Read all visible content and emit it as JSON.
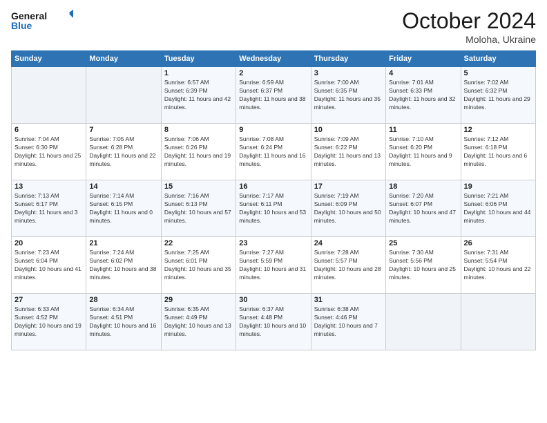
{
  "header": {
    "logo_line1": "General",
    "logo_line2": "Blue",
    "month": "October 2024",
    "location": "Moloha, Ukraine"
  },
  "weekdays": [
    "Sunday",
    "Monday",
    "Tuesday",
    "Wednesday",
    "Thursday",
    "Friday",
    "Saturday"
  ],
  "weeks": [
    [
      {
        "day": "",
        "info": ""
      },
      {
        "day": "",
        "info": ""
      },
      {
        "day": "1",
        "info": "Sunrise: 6:57 AM\nSunset: 6:39 PM\nDaylight: 11 hours and 42 minutes."
      },
      {
        "day": "2",
        "info": "Sunrise: 6:59 AM\nSunset: 6:37 PM\nDaylight: 11 hours and 38 minutes."
      },
      {
        "day": "3",
        "info": "Sunrise: 7:00 AM\nSunset: 6:35 PM\nDaylight: 11 hours and 35 minutes."
      },
      {
        "day": "4",
        "info": "Sunrise: 7:01 AM\nSunset: 6:33 PM\nDaylight: 11 hours and 32 minutes."
      },
      {
        "day": "5",
        "info": "Sunrise: 7:02 AM\nSunset: 6:32 PM\nDaylight: 11 hours and 29 minutes."
      }
    ],
    [
      {
        "day": "6",
        "info": "Sunrise: 7:04 AM\nSunset: 6:30 PM\nDaylight: 11 hours and 25 minutes."
      },
      {
        "day": "7",
        "info": "Sunrise: 7:05 AM\nSunset: 6:28 PM\nDaylight: 11 hours and 22 minutes."
      },
      {
        "day": "8",
        "info": "Sunrise: 7:06 AM\nSunset: 6:26 PM\nDaylight: 11 hours and 19 minutes."
      },
      {
        "day": "9",
        "info": "Sunrise: 7:08 AM\nSunset: 6:24 PM\nDaylight: 11 hours and 16 minutes."
      },
      {
        "day": "10",
        "info": "Sunrise: 7:09 AM\nSunset: 6:22 PM\nDaylight: 11 hours and 13 minutes."
      },
      {
        "day": "11",
        "info": "Sunrise: 7:10 AM\nSunset: 6:20 PM\nDaylight: 11 hours and 9 minutes."
      },
      {
        "day": "12",
        "info": "Sunrise: 7:12 AM\nSunset: 6:18 PM\nDaylight: 11 hours and 6 minutes."
      }
    ],
    [
      {
        "day": "13",
        "info": "Sunrise: 7:13 AM\nSunset: 6:17 PM\nDaylight: 11 hours and 3 minutes."
      },
      {
        "day": "14",
        "info": "Sunrise: 7:14 AM\nSunset: 6:15 PM\nDaylight: 11 hours and 0 minutes."
      },
      {
        "day": "15",
        "info": "Sunrise: 7:16 AM\nSunset: 6:13 PM\nDaylight: 10 hours and 57 minutes."
      },
      {
        "day": "16",
        "info": "Sunrise: 7:17 AM\nSunset: 6:11 PM\nDaylight: 10 hours and 53 minutes."
      },
      {
        "day": "17",
        "info": "Sunrise: 7:19 AM\nSunset: 6:09 PM\nDaylight: 10 hours and 50 minutes."
      },
      {
        "day": "18",
        "info": "Sunrise: 7:20 AM\nSunset: 6:07 PM\nDaylight: 10 hours and 47 minutes."
      },
      {
        "day": "19",
        "info": "Sunrise: 7:21 AM\nSunset: 6:06 PM\nDaylight: 10 hours and 44 minutes."
      }
    ],
    [
      {
        "day": "20",
        "info": "Sunrise: 7:23 AM\nSunset: 6:04 PM\nDaylight: 10 hours and 41 minutes."
      },
      {
        "day": "21",
        "info": "Sunrise: 7:24 AM\nSunset: 6:02 PM\nDaylight: 10 hours and 38 minutes."
      },
      {
        "day": "22",
        "info": "Sunrise: 7:25 AM\nSunset: 6:01 PM\nDaylight: 10 hours and 35 minutes."
      },
      {
        "day": "23",
        "info": "Sunrise: 7:27 AM\nSunset: 5:59 PM\nDaylight: 10 hours and 31 minutes."
      },
      {
        "day": "24",
        "info": "Sunrise: 7:28 AM\nSunset: 5:57 PM\nDaylight: 10 hours and 28 minutes."
      },
      {
        "day": "25",
        "info": "Sunrise: 7:30 AM\nSunset: 5:56 PM\nDaylight: 10 hours and 25 minutes."
      },
      {
        "day": "26",
        "info": "Sunrise: 7:31 AM\nSunset: 5:54 PM\nDaylight: 10 hours and 22 minutes."
      }
    ],
    [
      {
        "day": "27",
        "info": "Sunrise: 6:33 AM\nSunset: 4:52 PM\nDaylight: 10 hours and 19 minutes."
      },
      {
        "day": "28",
        "info": "Sunrise: 6:34 AM\nSunset: 4:51 PM\nDaylight: 10 hours and 16 minutes."
      },
      {
        "day": "29",
        "info": "Sunrise: 6:35 AM\nSunset: 4:49 PM\nDaylight: 10 hours and 13 minutes."
      },
      {
        "day": "30",
        "info": "Sunrise: 6:37 AM\nSunset: 4:48 PM\nDaylight: 10 hours and 10 minutes."
      },
      {
        "day": "31",
        "info": "Sunrise: 6:38 AM\nSunset: 4:46 PM\nDaylight: 10 hours and 7 minutes."
      },
      {
        "day": "",
        "info": ""
      },
      {
        "day": "",
        "info": ""
      }
    ]
  ]
}
